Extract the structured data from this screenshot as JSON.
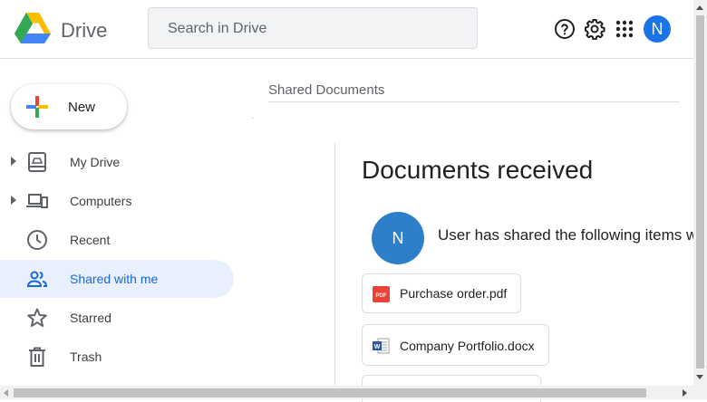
{
  "header": {
    "app_name": "Drive",
    "search_placeholder": "Search in Drive",
    "avatar_initial": "N"
  },
  "sidebar": {
    "new_label": "New",
    "items": [
      {
        "label": "My Drive"
      },
      {
        "label": "Computers"
      },
      {
        "label": "Recent"
      },
      {
        "label": "Shared with me"
      },
      {
        "label": "Starred"
      },
      {
        "label": "Trash"
      }
    ]
  },
  "main": {
    "page_title": "Shared Documents",
    "heading": "Documents received",
    "sharer_initial": "N",
    "share_message": "User has shared the following items with you",
    "files": [
      {
        "name": "Purchase order.pdf",
        "icon": "pdf-icon"
      },
      {
        "name": "Company Portfolio.docx",
        "icon": "word-doc-icon"
      }
    ]
  },
  "colors": {
    "accent": "#1a73e8",
    "active_nav_bg": "#e8f0fe",
    "active_nav_text": "#1967d2"
  }
}
